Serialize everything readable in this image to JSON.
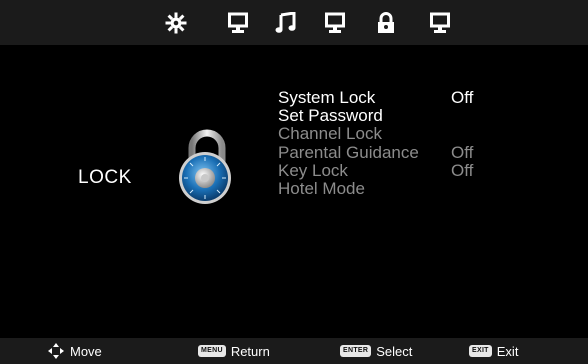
{
  "tabs": [
    {
      "name": "picture",
      "icon": "gear-icon",
      "active": true
    },
    {
      "name": "display",
      "icon": "monitor-icon"
    },
    {
      "name": "sound",
      "icon": "music-note-icon"
    },
    {
      "name": "setup",
      "icon": "monitor-icon"
    },
    {
      "name": "lock",
      "icon": "padlock-icon"
    },
    {
      "name": "channel",
      "icon": "monitor-icon"
    }
  ],
  "section": {
    "title": "LOCK",
    "icon": "combination-lock-icon"
  },
  "menu": [
    {
      "label": "System Lock",
      "value": "Off",
      "state": "active"
    },
    {
      "label": "Set Password",
      "value": "",
      "state": "active"
    },
    {
      "label": "Channel Lock",
      "value": "",
      "state": "disabled"
    },
    {
      "label": "Parental Guidance",
      "value": "Off",
      "state": "disabled"
    },
    {
      "label": "Key Lock",
      "value": "Off",
      "state": "disabled"
    },
    {
      "label": "Hotel Mode",
      "value": "",
      "state": "disabled"
    }
  ],
  "footer": {
    "move": {
      "label": "Move",
      "icon": "four-way-arrow-icon"
    },
    "return": {
      "key": "MENU",
      "label": "Return"
    },
    "select": {
      "key": "ENTER",
      "label": "Select"
    },
    "exit": {
      "key": "EXIT",
      "label": "Exit"
    }
  },
  "colors": {
    "bar": "#1b1b1b",
    "background": "#000000",
    "text_active": "#ffffff",
    "text_disabled": "#8c8c8c",
    "lock_blue": "#1a6fb5"
  }
}
